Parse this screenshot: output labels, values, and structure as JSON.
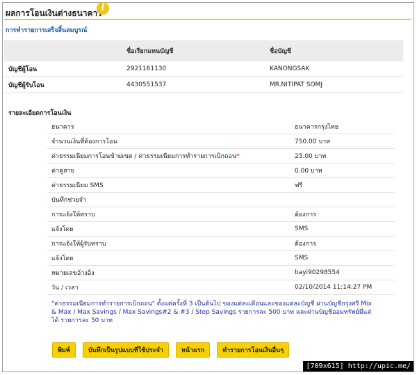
{
  "page": {
    "title": "ผลการโอนเงินต่างธนาคาร",
    "info_icon": "info-icon",
    "status": "การทำรายการเสร็จสิ้นสมบูรณ์"
  },
  "accounts": {
    "headers": [
      "ชื่อเรียกแทนบัญชี",
      "ชื่อบัญชี"
    ],
    "rows": [
      {
        "label": "บัญชีผู้โอน",
        "number": "2921161130",
        "name": "KANONGSAK"
      },
      {
        "label": "บัญชีผู้รับโอน",
        "number": "4430551537",
        "name": "MR.NITIPAT SOMJ"
      }
    ]
  },
  "details": {
    "heading": "รายละเอียดการโอนเงิน",
    "rows": [
      {
        "label": "ธนาคาร",
        "value": "ธนาคารกรุงไทย"
      },
      {
        "label": "จำนวนเงินที่ต้องการโอน",
        "value": "750.00 บาท"
      },
      {
        "label": "ค่าธรรมเนียมการโอนข้ามเขต / ค่าธรรมเนียมการทำรายการเบิกถอน",
        "req": "*",
        "value": "25.00 บาท"
      },
      {
        "label": "ค่าคู่สาย",
        "value": "0.00 บาท"
      },
      {
        "label": "ค่าธรรมเนียม SMS",
        "value": "ฟรี"
      },
      {
        "label": "บันทึกช่วยจำ",
        "value": ""
      },
      {
        "label": "การแจ้งให้ทราบ",
        "value": "ต้องการ"
      },
      {
        "label": "แจ้งโดย",
        "value": "SMS"
      },
      {
        "label": "การแจ้งให้ผู้รับทราบ",
        "value": "ต้องการ"
      },
      {
        "label": "แจ้งโดย",
        "value": "SMS"
      },
      {
        "label": "หมายเลขอ้างอิง",
        "value": "bayi90298554"
      },
      {
        "label": "วัน / เวลา",
        "value": "02/10/2014 11:14:27 PM"
      }
    ]
  },
  "note": "\"ค่าธรรมเนียมการทำรายการเบิกถอน\" ตั้งแต่ครั้งที่ 3 เป็นต้นไป ของแต่ละเดือนและของแต่ละบัญชี ผ่านบัญชีกรุงศรี Mix & Max / Max Savings / Max Savings#2 & #3 / Step Savings รายการละ 500 บาท และผ่านบัญชีออมทรัพย์มีแต่ได้ รายการละ 50 บาท",
  "buttons": {
    "print": "พิมพ์",
    "save_template": "บันทึกเป็นรูปแบบที่ใช้ประจำ",
    "home": "หน้าแรก",
    "new_transfer": "ทำรายการโอนเงินอื่นๆ"
  },
  "credit": "[709x615] http://upic.me/",
  "colors": {
    "accent": "#f7d008",
    "link": "#1a5ea8",
    "note": "#1a2f9c"
  }
}
